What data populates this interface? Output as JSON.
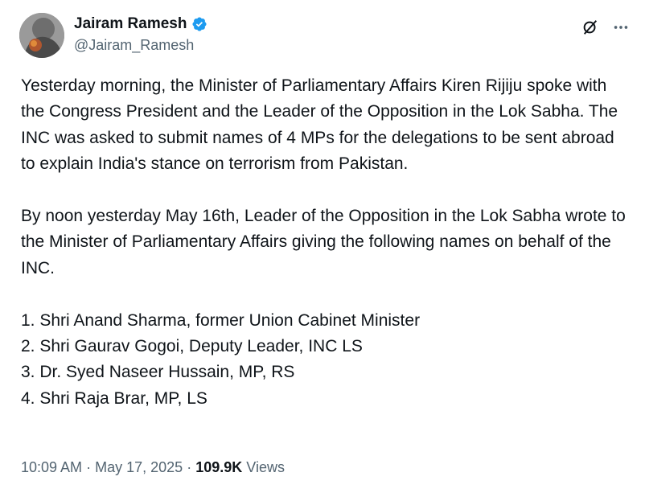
{
  "author": {
    "display_name": "Jairam Ramesh",
    "handle": "@Jairam_Ramesh",
    "verified": true,
    "verified_color": "#1d9bf0"
  },
  "icons": {
    "grok": "grok-icon",
    "more": "more-options-icon",
    "verified": "verified-badge-icon"
  },
  "tweet": {
    "paragraph_1": "Yesterday morning, the Minister of Parliamentary Affairs Kiren Rijiju spoke with the Congress President and the Leader of the Opposition in the Lok Sabha. The INC was asked to submit names of 4 MPs for the delegations to be sent abroad to explain India's stance on terrorism from Pakistan.",
    "paragraph_2": "By noon yesterday May 16th, Leader of the Opposition in the Lok Sabha wrote to the Minister of Parliamentary Affairs giving the following names on behalf of the INC.",
    "list": [
      "1. Shri Anand Sharma, former Union Cabinet Minister",
      "2. Shri Gaurav Gogoi, Deputy Leader, INC LS",
      "3. Dr. Syed Naseer Hussain, MP, RS",
      "4. Shri Raja Brar, MP, LS"
    ]
  },
  "meta": {
    "time": "10:09 AM",
    "date": "May 17, 2025",
    "separator": "·",
    "views_count": "109.9K",
    "views_label": "Views"
  },
  "colors": {
    "text": "#0f1419",
    "secondary": "#536471"
  }
}
